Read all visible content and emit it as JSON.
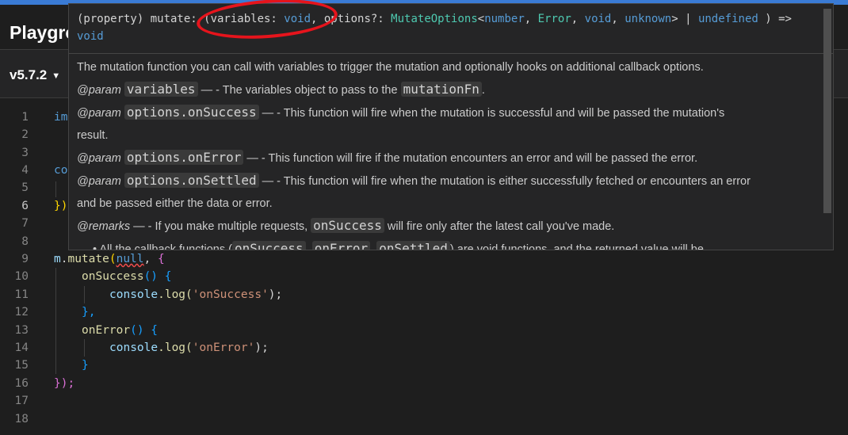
{
  "app": {
    "title": "Playgro"
  },
  "version": {
    "label": "v5.7.2"
  },
  "editor": {
    "line_numbers": [
      "1",
      "2",
      "3",
      "4",
      "5",
      "6",
      "7",
      "8",
      "9",
      "10",
      "11",
      "12",
      "13",
      "14",
      "15",
      "16",
      "17",
      "18"
    ],
    "lines": {
      "l1": "im",
      "l4": "co",
      "l6": "})",
      "l9_obj": "m",
      "l9_dot": ".",
      "l9_fn": "mutate",
      "l9_open": "(",
      "l9_null": "null",
      "l9_comma": ", ",
      "l9_brace": "{",
      "l10_fn": "onSuccess",
      "l10_rest": "() {",
      "l11_obj": "console",
      "l11_fn": ".log(",
      "l11_str": "'onSuccess'",
      "l11_end": ");",
      "l12": "},",
      "l13_fn": "onError",
      "l13_rest": "() {",
      "l14_obj": "console",
      "l14_fn": ".log(",
      "l14_str": "'onError'",
      "l14_end": ");",
      "l15": "}",
      "l16": "});"
    }
  },
  "hover": {
    "sig": {
      "prefix": "(property) mutate: (variables: ",
      "void1": "void",
      "mid": ", options?: ",
      "type": "MutateOptions",
      "lt": "<",
      "number": "number",
      "c1": ", ",
      "error": "Error",
      "c2": ", ",
      "void2": "void",
      "c3": ", ",
      "unknown": "unknown",
      "gt": "> | ",
      "undefined": "undefined",
      "arrow": ") =>",
      "ret": "void"
    },
    "doc": {
      "intro": "The mutation function you can call with variables to trigger the mutation and optionally hooks on additional callback options.",
      "param_tag": "@param",
      "p1_name": "variables",
      "p1_text": " — - The variables object to pass to the ",
      "p1_code": "mutationFn",
      "p1_end": ".",
      "p2_name": "options.onSuccess",
      "p2_text": " — - This function will fire when the mutation is successful and will be passed the mutation's",
      "p2_cont": "result.",
      "p3_name": "options.onError",
      "p3_text": " — - This function will fire if the mutation encounters an error and will be passed the error.",
      "p4_name": "options.onSettled",
      "p4_text": " — - This function will fire when the mutation is either successfully fetched or encounters an error",
      "p4_cont": "and be passed either the data or error.",
      "remarks_tag": "@remarks",
      "remarks_text": " — - If you make multiple requests, ",
      "remarks_code": "onSuccess",
      "remarks_end": " will fire only after the latest call you've made.",
      "bullet_text": "All the callback functions (",
      "bullet_code1": "onSuccess",
      "bullet_sep1": ", ",
      "bullet_code2": "onError",
      "bullet_sep2": ", ",
      "bullet_code3": "onSettled",
      "bullet_end": ") are void functions, and the returned value will be"
    }
  },
  "colors": {
    "annotation": "#e6141c",
    "accent": "#3a7bd5"
  }
}
